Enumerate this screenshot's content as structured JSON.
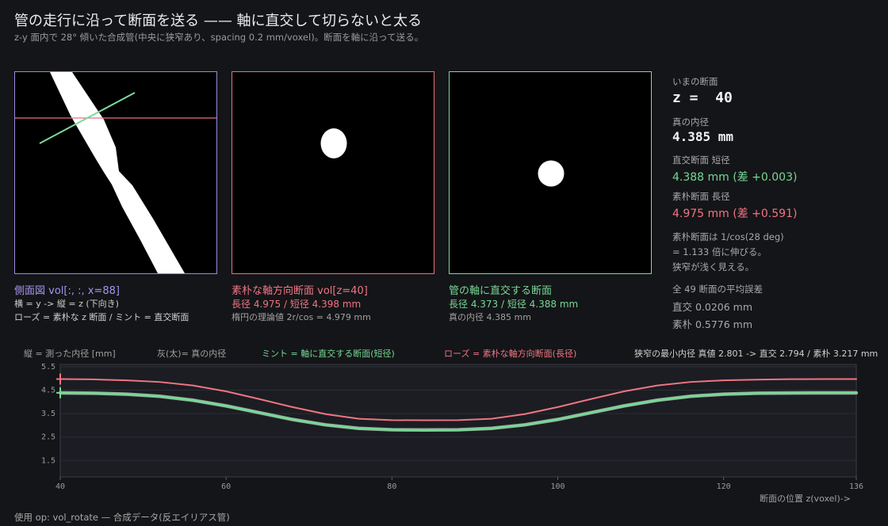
{
  "header": {
    "title": "管の走行に沿って断面を送る —— 軸に直交して切らないと太る",
    "subtitle": "z-y 面内で 28° 傾いた合成管(中央に狭窄あり、spacing 0.2 mm/voxel)。断面を軸に沿って送る。"
  },
  "panels": {
    "side": {
      "title": "側面図 vol[:, :, x=88]",
      "line1": "横 = y ->   縦 = z (下向き)",
      "line2": "ローズ = 素朴な z 断面 / ミント = 直交断面"
    },
    "naive": {
      "title": "素朴な軸方向断面 vol[z=40]",
      "line1": "長径 4.975 / 短径 4.398 mm",
      "line2": "楕円の理論値 2r/cos = 4.979 mm"
    },
    "perp": {
      "title": "管の軸に直交する断面",
      "line1": "長径 4.373 / 短径 4.388 mm",
      "line2": "真の内径 4.385 mm"
    }
  },
  "info": {
    "current_label": "いまの断面",
    "current_value": "z =  40",
    "true_label": "真の内径",
    "true_value": "4.385 mm",
    "perp_label": "直交断面 短径",
    "perp_value": "4.388 mm (差 +0.003)",
    "naive_label": "素朴断面 長径",
    "naive_value": "4.975 mm (差 +0.591)",
    "note1": "素朴断面は 1/cos(28 deg)",
    "note2": "= 1.133 倍に伸びる。",
    "note3": "狭窄が浅く見える。",
    "avg_label": "全 49 断面の平均誤差",
    "avg_perp": "直交 0.0206 mm",
    "avg_naive": "素朴 0.5776 mm"
  },
  "legend": {
    "ylabel": "縦 = 測った内径 [mm]",
    "grey": "灰(太)= 真の内径",
    "mint": "ミント = 軸に直交する断面(短径)",
    "rose": "ローズ = 素朴な軸方向断面(長径)",
    "stenosis": "狭窄の最小内径 真値 2.801 -> 直交 2.794 / 素朴 3.217 mm",
    "xlabel": "断面の位置 z(voxel)->"
  },
  "colors": {
    "background": "#141518",
    "rose": "#f07583",
    "mint": "#76d894",
    "purple": "#a693f0",
    "true_grey": "#9a9a9a"
  },
  "chart_data": {
    "type": "line",
    "xlim": [
      40,
      136
    ],
    "ylim": [
      0.8,
      5.6
    ],
    "xticks": [
      40,
      60,
      80,
      100,
      120,
      136
    ],
    "yticks": [
      1.5,
      2.5,
      3.5,
      4.5,
      5.5
    ],
    "current_z": 40,
    "x": [
      40,
      44,
      48,
      52,
      56,
      60,
      64,
      68,
      72,
      76,
      80,
      84,
      88,
      92,
      96,
      100,
      104,
      108,
      112,
      116,
      120,
      124,
      128,
      132,
      136
    ],
    "series": [
      {
        "name": "灰(太)= 真の内径",
        "color": "#9a9a9a",
        "values": [
          4.385,
          4.37,
          4.33,
          4.24,
          4.07,
          3.83,
          3.54,
          3.25,
          3.02,
          2.87,
          2.81,
          2.801,
          2.81,
          2.87,
          3.02,
          3.25,
          3.54,
          3.83,
          4.07,
          4.24,
          4.33,
          4.37,
          4.38,
          4.385,
          4.385
        ]
      },
      {
        "name": "ミント = 軸に直交する断面(短径)",
        "color": "#76d894",
        "values": [
          4.388,
          4.37,
          4.33,
          4.24,
          4.07,
          3.83,
          3.54,
          3.25,
          3.02,
          2.87,
          2.81,
          2.794,
          2.8,
          2.87,
          3.02,
          3.25,
          3.54,
          3.83,
          4.07,
          4.24,
          4.33,
          4.37,
          4.38,
          4.39,
          4.39
        ]
      },
      {
        "name": "ローズ = 素朴な軸方向断面(長径)",
        "color": "#f07583",
        "values": [
          4.975,
          4.96,
          4.92,
          4.85,
          4.7,
          4.45,
          4.12,
          3.78,
          3.48,
          3.28,
          3.22,
          3.217,
          3.22,
          3.28,
          3.48,
          3.78,
          4.12,
          4.45,
          4.7,
          4.85,
          4.92,
          4.95,
          4.97,
          4.975,
          4.975
        ]
      }
    ]
  }
}
